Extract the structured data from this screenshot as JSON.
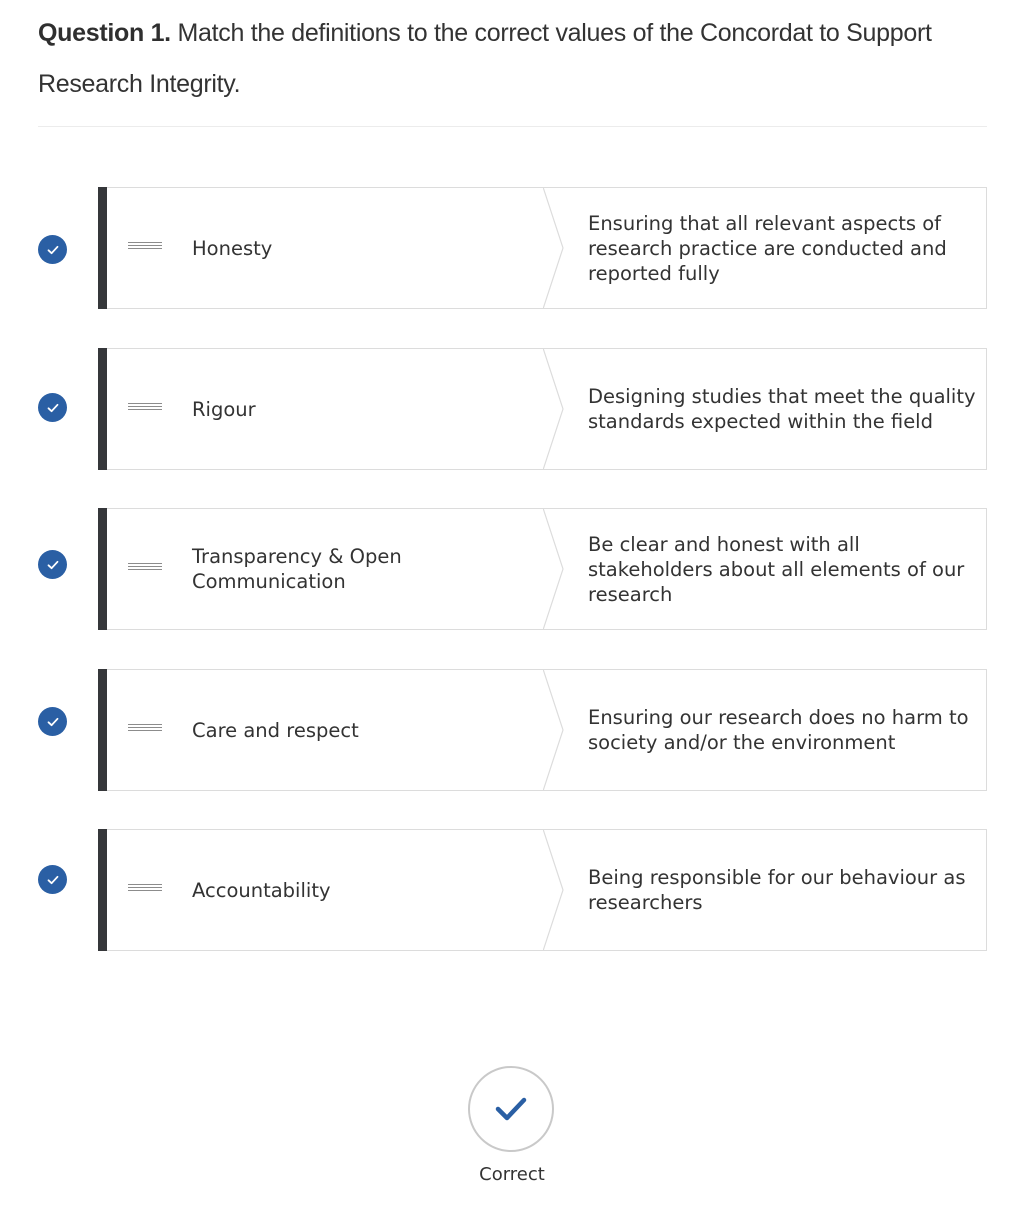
{
  "question": {
    "number_label": "Question 1.",
    "text": " Match the definitions to the correct values of the Concordat to Support Research Integrity."
  },
  "pairs": [
    {
      "term": "Honesty",
      "definition": "Ensuring that all relevant aspects of research practice are conducted and reported fully",
      "status": "correct"
    },
    {
      "term": "Rigour",
      "definition": "Designing studies that meet the quality standards expected within the field",
      "status": "correct"
    },
    {
      "term": "Transparency & Open Communication",
      "definition": "Be clear and honest with all stakeholders about all elements of our research",
      "status": "correct"
    },
    {
      "term": "Care and respect",
      "definition": "Ensuring our research does no harm to society and/or the environment",
      "status": "correct"
    },
    {
      "term": "Accountability",
      "definition": "Being responsible for our behaviour as researchers",
      "status": "correct"
    }
  ],
  "result": {
    "label": "Correct",
    "icon": "checkmark-icon"
  },
  "colors": {
    "accent": "#2a5fa4",
    "card_bar": "#35373a",
    "card_border": "#dcdcdc",
    "text": "#333333"
  }
}
